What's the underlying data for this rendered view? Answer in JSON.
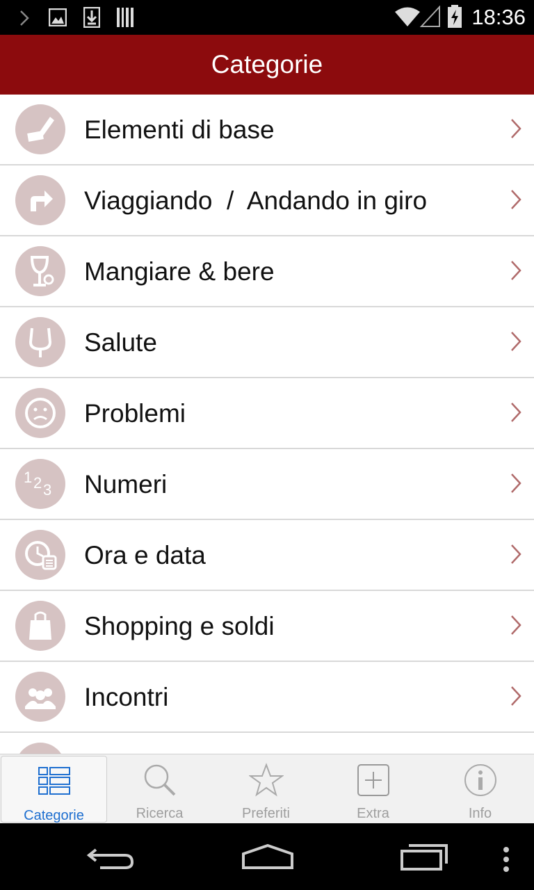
{
  "status_bar": {
    "time": "18:36"
  },
  "header": {
    "title": "Categorie"
  },
  "categories": [
    {
      "label": "Elementi di base",
      "icon": "pencil-icon"
    },
    {
      "label": "Viaggiando  /  Andando in giro",
      "icon": "turn-right-arrow-icon"
    },
    {
      "label": "Mangiare & bere",
      "icon": "glass-icon"
    },
    {
      "label": "Salute",
      "icon": "stethoscope-icon"
    },
    {
      "label": "Problemi",
      "icon": "sad-face-icon"
    },
    {
      "label": "Numeri",
      "icon": "numbers-123-icon"
    },
    {
      "label": "Ora e data",
      "icon": "clock-calendar-icon"
    },
    {
      "label": "Shopping e soldi",
      "icon": "shopping-bag-icon"
    },
    {
      "label": "Incontri",
      "icon": "people-icon"
    }
  ],
  "tabs": [
    {
      "label": "Categorie",
      "icon": "list-grid-icon",
      "active": true
    },
    {
      "label": "Ricerca",
      "icon": "search-icon",
      "active": false
    },
    {
      "label": "Preferiti",
      "icon": "star-icon",
      "active": false
    },
    {
      "label": "Extra",
      "icon": "plus-box-icon",
      "active": false
    },
    {
      "label": "Info",
      "icon": "info-icon",
      "active": false
    }
  ],
  "colors": {
    "header_bg": "#8c0b0d",
    "icon_circle": "#d6c3c3",
    "chevron": "#b06a6a",
    "active_tab": "#1e6fd0",
    "inactive_tab": "#9e9e9e"
  }
}
